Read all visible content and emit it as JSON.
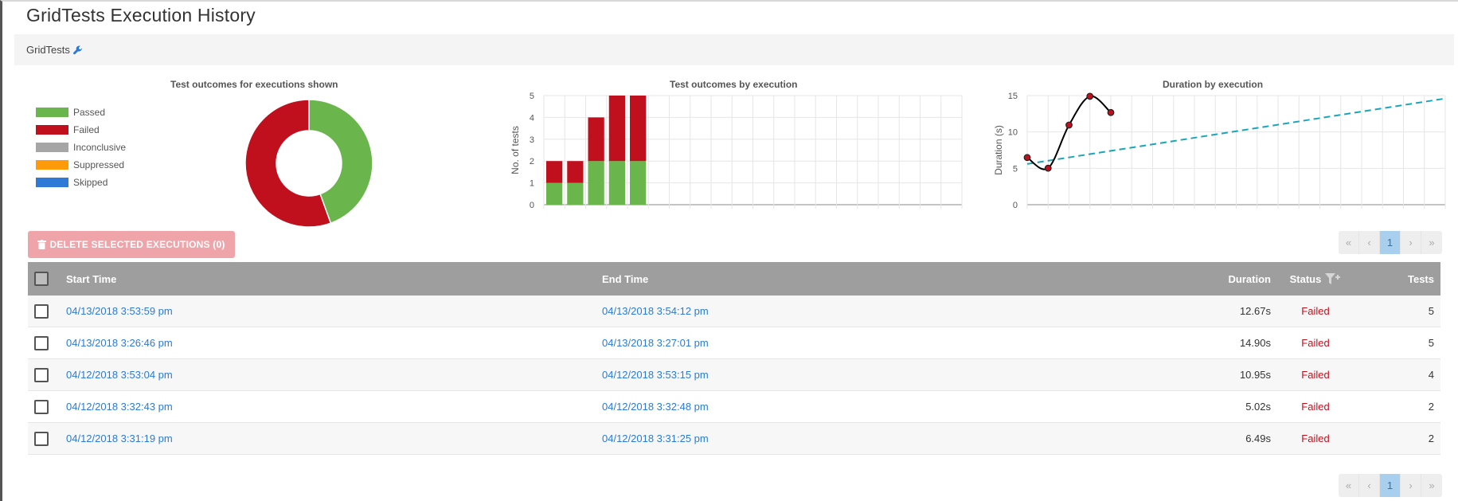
{
  "page": {
    "title": "GridTests Execution History"
  },
  "breadcrumb": {
    "label": "GridTests"
  },
  "charts": {
    "donut_title": "Test outcomes for executions shown",
    "bar_title": "Test outcomes by execution",
    "line_title": "Duration by execution",
    "legend": [
      {
        "label": "Passed",
        "color": "#6ab64c"
      },
      {
        "label": "Failed",
        "color": "#c0101e"
      },
      {
        "label": "Inconclusive",
        "color": "#a6a6a6"
      },
      {
        "label": "Suppressed",
        "color": "#ff9b0a"
      },
      {
        "label": "Skipped",
        "color": "#2f7ad6"
      }
    ]
  },
  "chart_data": [
    {
      "type": "pie",
      "title": "Test outcomes for executions shown",
      "categories": [
        "Passed",
        "Failed",
        "Inconclusive",
        "Suppressed",
        "Skipped"
      ],
      "values": [
        8,
        10,
        0,
        0,
        0
      ],
      "colors": [
        "#6ab64c",
        "#c0101e",
        "#a6a6a6",
        "#ff9b0a",
        "#2f7ad6"
      ]
    },
    {
      "type": "bar",
      "title": "Test outcomes by execution",
      "ylabel": "No. of tests",
      "ylim": [
        0,
        5
      ],
      "yticks": [
        "0",
        "1",
        "2",
        "3",
        "4",
        "5"
      ],
      "slots": 20,
      "series": [
        {
          "name": "Passed",
          "color": "#6ab64c",
          "values": [
            1,
            1,
            2,
            2,
            2
          ]
        },
        {
          "name": "Failed",
          "color": "#c0101e",
          "values": [
            1,
            1,
            2,
            3,
            3
          ]
        }
      ]
    },
    {
      "type": "line",
      "title": "Duration by execution",
      "ylabel": "Duration (s)",
      "ylim": [
        0,
        15
      ],
      "yticks": [
        "0",
        "5",
        "10",
        "15"
      ],
      "slots": 20,
      "series": [
        {
          "color": "#000000",
          "values": [
            6.49,
            5.02,
            10.95,
            14.9,
            12.67
          ]
        }
      ],
      "trendline": {
        "color": "#1aa5b8",
        "start": 5.6,
        "end": 14.6
      }
    }
  ],
  "toolbar": {
    "delete_label": "DELETE SELECTED EXECUTIONS (0)"
  },
  "pager": {
    "first": "«",
    "prev": "‹",
    "page": "1",
    "next": "›",
    "last": "»"
  },
  "table": {
    "columns": {
      "start": "Start Time",
      "end": "End Time",
      "duration": "Duration",
      "status": "Status",
      "tests": "Tests"
    },
    "rows": [
      {
        "start": "04/13/2018 3:53:59 pm",
        "end": "04/13/2018 3:54:12 pm",
        "duration": "12.67s",
        "status": "Failed",
        "tests": "5"
      },
      {
        "start": "04/13/2018 3:26:46 pm",
        "end": "04/13/2018 3:27:01 pm",
        "duration": "14.90s",
        "status": "Failed",
        "tests": "5"
      },
      {
        "start": "04/12/2018 3:53:04 pm",
        "end": "04/12/2018 3:53:15 pm",
        "duration": "10.95s",
        "status": "Failed",
        "tests": "4"
      },
      {
        "start": "04/12/2018 3:32:43 pm",
        "end": "04/12/2018 3:32:48 pm",
        "duration": "5.02s",
        "status": "Failed",
        "tests": "2"
      },
      {
        "start": "04/12/2018 3:31:19 pm",
        "end": "04/12/2018 3:31:25 pm",
        "duration": "6.49s",
        "status": "Failed",
        "tests": "2"
      }
    ]
  }
}
